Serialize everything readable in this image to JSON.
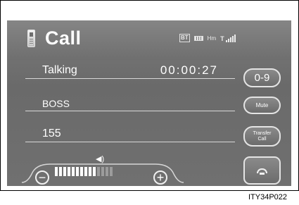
{
  "header": {
    "title": "Call",
    "status": {
      "bt_label": "BT",
      "hm_label": "Hm",
      "signal_label": "T"
    }
  },
  "call": {
    "status_label": "Talking",
    "timer": "00:00:27",
    "contact_name": "BOSS",
    "number": "155"
  },
  "buttons": {
    "keypad": "0-9",
    "mute": "Mute",
    "transfer_line1": "Transfer",
    "transfer_line2": "Call"
  },
  "volume": {
    "level": 10,
    "max": 14,
    "minus": "−",
    "plus": "+"
  },
  "caption": "ITY34P022"
}
